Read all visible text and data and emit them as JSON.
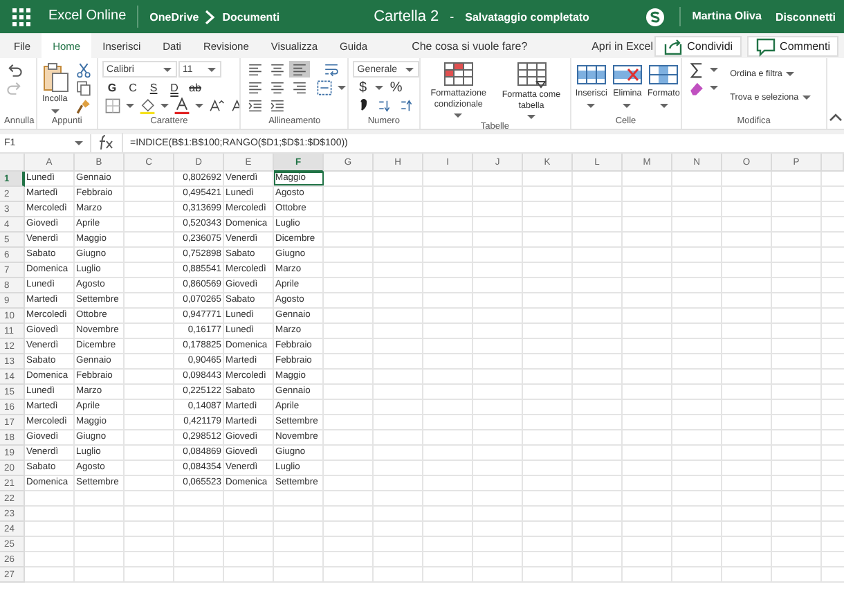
{
  "top_bar": {
    "app_name": "Excel Online",
    "breadcrumb": [
      "OneDrive",
      "Documenti"
    ],
    "file_title": "Cartella 2",
    "separator": "-",
    "save_status": "Salvataggio completato",
    "user_name": "Martina Oliva",
    "sign_out": "Disconnetti"
  },
  "tabs": [
    {
      "label": "File",
      "selected": false
    },
    {
      "label": "Home",
      "selected": true
    },
    {
      "label": "Inserisci",
      "selected": false
    },
    {
      "label": "Dati",
      "selected": false
    },
    {
      "label": "Revisione",
      "selected": false
    },
    {
      "label": "Visualizza",
      "selected": false
    },
    {
      "label": "Guida",
      "selected": false
    }
  ],
  "tell_me": {
    "placeholder": "Che cosa si vuole fare?"
  },
  "open_in_desktop": "Apri in Excel",
  "share_button": "Condividi",
  "comments_button": "Commenti",
  "ribbon": [
    {
      "kind": "undo",
      "label": "Annulla"
    },
    {
      "kind": "clipboard",
      "label": "Appunti",
      "paste": "Incolla"
    },
    {
      "kind": "font",
      "label": "Carattere",
      "font": "Calibri",
      "size": "11",
      "styles": [
        "G",
        "C",
        "S",
        "D",
        "ab"
      ]
    },
    {
      "kind": "align",
      "label": "Allineamento"
    },
    {
      "kind": "number",
      "label": "Numero",
      "format": "Generale",
      "symbols": [
        "$",
        "%"
      ]
    },
    {
      "kind": "tables",
      "label": "Tabelle",
      "buttons": [
        "Formattazione condizionale",
        "Formatta come tabella"
      ]
    },
    {
      "kind": "cells",
      "label": "Celle",
      "buttons": [
        "Inserisci",
        "Elimina",
        "Formato"
      ]
    },
    {
      "kind": "editing",
      "label": "Modifica",
      "menus": [
        "Ordina e filtra",
        "Trova e seleziona"
      ]
    }
  ],
  "formula_bar": {
    "name_box": "F1",
    "formula": "=INDICE(B$1:B$100;RANGO($D1;$D$1:$D$100))"
  },
  "sheet": {
    "columns": [
      {
        "label": "A",
        "kind": "text",
        "selected": false
      },
      {
        "label": "B",
        "kind": "text",
        "selected": false
      },
      {
        "label": "C",
        "kind": "text",
        "selected": false
      },
      {
        "label": "D",
        "kind": "number",
        "selected": false
      },
      {
        "label": "E",
        "kind": "text",
        "selected": false
      },
      {
        "label": "F",
        "kind": "text",
        "selected": true
      },
      {
        "label": "G",
        "kind": "text",
        "selected": false
      },
      {
        "label": "H",
        "kind": "text",
        "selected": false
      },
      {
        "label": "I",
        "kind": "text",
        "selected": false
      },
      {
        "label": "J",
        "kind": "text",
        "selected": false
      },
      {
        "label": "K",
        "kind": "text",
        "selected": false
      },
      {
        "label": "L",
        "kind": "text",
        "selected": false
      },
      {
        "label": "M",
        "kind": "text",
        "selected": false
      },
      {
        "label": "N",
        "kind": "text",
        "selected": false
      },
      {
        "label": "O",
        "kind": "text",
        "selected": false
      },
      {
        "label": "P",
        "kind": "text",
        "selected": false
      }
    ],
    "rows": [
      {
        "header": "1",
        "selected": true,
        "cells": [
          "Lunedì",
          "Gennaio",
          "",
          "0,802692",
          "Venerdì",
          "Maggio"
        ]
      },
      {
        "header": "2",
        "selected": false,
        "cells": [
          "Martedì",
          "Febbraio",
          "",
          "0,495421",
          "Lunedì",
          "Agosto"
        ]
      },
      {
        "header": "3",
        "selected": false,
        "cells": [
          "Mercoledì",
          "Marzo",
          "",
          "0,313699",
          "Mercoledì",
          "Ottobre"
        ]
      },
      {
        "header": "4",
        "selected": false,
        "cells": [
          "Giovedì",
          "Aprile",
          "",
          "0,520343",
          "Domenica",
          "Luglio"
        ]
      },
      {
        "header": "5",
        "selected": false,
        "cells": [
          "Venerdì",
          "Maggio",
          "",
          "0,236075",
          "Venerdì",
          "Dicembre"
        ]
      },
      {
        "header": "6",
        "selected": false,
        "cells": [
          "Sabato",
          "Giugno",
          "",
          "0,752898",
          "Sabato",
          "Giugno"
        ]
      },
      {
        "header": "7",
        "selected": false,
        "cells": [
          "Domenica",
          "Luglio",
          "",
          "0,885541",
          "Mercoledì",
          "Marzo"
        ]
      },
      {
        "header": "8",
        "selected": false,
        "cells": [
          "Lunedì",
          "Agosto",
          "",
          "0,860569",
          "Giovedì",
          "Aprile"
        ]
      },
      {
        "header": "9",
        "selected": false,
        "cells": [
          "Martedì",
          "Settembre",
          "",
          "0,070265",
          "Sabato",
          "Agosto"
        ]
      },
      {
        "header": "10",
        "selected": false,
        "cells": [
          "Mercoledì",
          "Ottobre",
          "",
          "0,947771",
          "Lunedì",
          "Gennaio"
        ]
      },
      {
        "header": "11",
        "selected": false,
        "cells": [
          "Giovedì",
          "Novembre",
          "",
          "0,16177",
          "Lunedì",
          "Marzo"
        ]
      },
      {
        "header": "12",
        "selected": false,
        "cells": [
          "Venerdì",
          "Dicembre",
          "",
          "0,178825",
          "Domenica",
          "Febbraio"
        ]
      },
      {
        "header": "13",
        "selected": false,
        "cells": [
          "Sabato",
          "Gennaio",
          "",
          "0,90465",
          "Martedì",
          "Febbraio"
        ]
      },
      {
        "header": "14",
        "selected": false,
        "cells": [
          "Domenica",
          "Febbraio",
          "",
          "0,098443",
          "Mercoledì",
          "Maggio"
        ]
      },
      {
        "header": "15",
        "selected": false,
        "cells": [
          "Lunedì",
          "Marzo",
          "",
          "0,225122",
          "Sabato",
          "Gennaio"
        ]
      },
      {
        "header": "16",
        "selected": false,
        "cells": [
          "Martedì",
          "Aprile",
          "",
          "0,14087",
          "Martedì",
          "Aprile"
        ]
      },
      {
        "header": "17",
        "selected": false,
        "cells": [
          "Mercoledì",
          "Maggio",
          "",
          "0,421179",
          "Martedì",
          "Settembre"
        ]
      },
      {
        "header": "18",
        "selected": false,
        "cells": [
          "Giovedì",
          "Giugno",
          "",
          "0,298512",
          "Giovedì",
          "Novembre"
        ]
      },
      {
        "header": "19",
        "selected": false,
        "cells": [
          "Venerdì",
          "Luglio",
          "",
          "0,084869",
          "Giovedì",
          "Giugno"
        ]
      },
      {
        "header": "20",
        "selected": false,
        "cells": [
          "Sabato",
          "Agosto",
          "",
          "0,084354",
          "Venerdì",
          "Luglio"
        ]
      },
      {
        "header": "21",
        "selected": false,
        "cells": [
          "Domenica",
          "Settembre",
          "",
          "0,065523",
          "Domenica",
          "Settembre"
        ]
      },
      {
        "header": "22",
        "selected": false
      },
      {
        "header": "23",
        "selected": false
      },
      {
        "header": "24",
        "selected": false
      },
      {
        "header": "25",
        "selected": false
      },
      {
        "header": "26",
        "selected": false
      },
      {
        "header": "27",
        "selected": false
      }
    ]
  }
}
